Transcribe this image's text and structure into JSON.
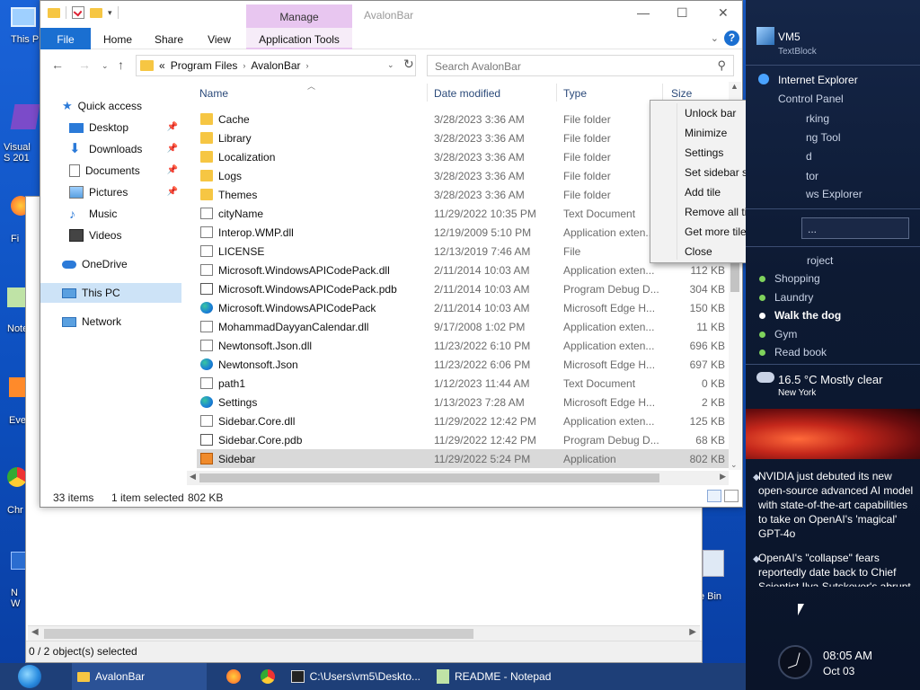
{
  "desktop": {
    "icons": [
      {
        "label": "This P",
        "icon": "pc-icon"
      },
      {
        "label": "Visual S 201",
        "icon": "visual-studio-icon"
      },
      {
        "label": "Fi",
        "icon": "firefox-icon"
      },
      {
        "label": "Note",
        "icon": "notepad-icon"
      },
      {
        "label": "Eve",
        "icon": "app-icon"
      },
      {
        "label": "Chr",
        "icon": "chrome-icon"
      },
      {
        "label": "N W",
        "icon": "app-icon"
      },
      {
        "label": "cle Bin",
        "icon": "recycle-bin-icon"
      }
    ]
  },
  "background_window": {
    "status": "0 / 2 object(s) selected"
  },
  "explorer": {
    "title": "AvalonBar",
    "manage_tab": "Manage",
    "ribbon_tabs": [
      "File",
      "Home",
      "Share",
      "View",
      "Application Tools"
    ],
    "address": {
      "root_glyph": "«",
      "crumbs": [
        "Program Files",
        "AvalonBar"
      ]
    },
    "search_placeholder": "Search AvalonBar",
    "nav": {
      "quick_access": "Quick access",
      "items": [
        {
          "label": "Desktop",
          "pinned": true,
          "icon": "desktop-icon"
        },
        {
          "label": "Downloads",
          "pinned": true,
          "icon": "downloads-icon"
        },
        {
          "label": "Documents",
          "pinned": true,
          "icon": "documents-icon"
        },
        {
          "label": "Pictures",
          "pinned": true,
          "icon": "pictures-icon"
        },
        {
          "label": "Music",
          "pinned": false,
          "icon": "music-icon"
        },
        {
          "label": "Videos",
          "pinned": false,
          "icon": "videos-icon"
        }
      ],
      "onedrive": "OneDrive",
      "thispc": "This PC",
      "network": "Network"
    },
    "columns": {
      "name": "Name",
      "date": "Date modified",
      "type": "Type",
      "size": "Size"
    },
    "files": [
      {
        "name": "Cache",
        "date": "3/28/2023 3:36 AM",
        "type": "File folder",
        "size": "",
        "icon": "folder"
      },
      {
        "name": "Library",
        "date": "3/28/2023 3:36 AM",
        "type": "File folder",
        "size": "",
        "icon": "folder"
      },
      {
        "name": "Localization",
        "date": "3/28/2023 3:36 AM",
        "type": "File folder",
        "size": "",
        "icon": "folder"
      },
      {
        "name": "Logs",
        "date": "3/28/2023 3:36 AM",
        "type": "File folder",
        "size": "",
        "icon": "folder"
      },
      {
        "name": "Themes",
        "date": "3/28/2023 3:36 AM",
        "type": "File folder",
        "size": "",
        "icon": "folder"
      },
      {
        "name": "cityName",
        "date": "11/29/2022 10:35 PM",
        "type": "Text Document",
        "size": "",
        "icon": "doc"
      },
      {
        "name": "Interop.WMP.dll",
        "date": "12/19/2009 5:10 PM",
        "type": "Application exten...",
        "size": "",
        "icon": "dll"
      },
      {
        "name": "LICENSE",
        "date": "12/13/2019 7:46 AM",
        "type": "File",
        "size": "",
        "icon": "doc"
      },
      {
        "name": "Microsoft.WindowsAPICodePack.dll",
        "date": "2/11/2014 10:03 AM",
        "type": "Application exten...",
        "size": "112 KB",
        "icon": "dll"
      },
      {
        "name": "Microsoft.WindowsAPICodePack.pdb",
        "date": "2/11/2014 10:03 AM",
        "type": "Program Debug D...",
        "size": "304 KB",
        "icon": "pdb"
      },
      {
        "name": "Microsoft.WindowsAPICodePack",
        "date": "2/11/2014 10:03 AM",
        "type": "Microsoft Edge H...",
        "size": "150 KB",
        "icon": "edge"
      },
      {
        "name": "MohammadDayyanCalendar.dll",
        "date": "9/17/2008 1:02 PM",
        "type": "Application exten...",
        "size": "11 KB",
        "icon": "dll"
      },
      {
        "name": "Newtonsoft.Json.dll",
        "date": "11/23/2022 6:10 PM",
        "type": "Application exten...",
        "size": "696 KB",
        "icon": "dll"
      },
      {
        "name": "Newtonsoft.Json",
        "date": "11/23/2022 6:06 PM",
        "type": "Microsoft Edge H...",
        "size": "697 KB",
        "icon": "edge"
      },
      {
        "name": "path1",
        "date": "1/12/2023 11:44 AM",
        "type": "Text Document",
        "size": "0 KB",
        "icon": "doc"
      },
      {
        "name": "Settings",
        "date": "1/13/2023 7:28 AM",
        "type": "Microsoft Edge H...",
        "size": "2 KB",
        "icon": "edge"
      },
      {
        "name": "Sidebar.Core.dll",
        "date": "11/29/2022 12:42 PM",
        "type": "Application exten...",
        "size": "125 KB",
        "icon": "dll"
      },
      {
        "name": "Sidebar.Core.pdb",
        "date": "11/29/2022 12:42 PM",
        "type": "Program Debug D...",
        "size": "68 KB",
        "icon": "pdb"
      },
      {
        "name": "Sidebar",
        "date": "11/29/2022 5:24 PM",
        "type": "Application",
        "size": "802 KB",
        "icon": "app",
        "selected": true
      }
    ],
    "status": {
      "count": "33 items",
      "selected": "1 item selected",
      "size": "802 KB"
    }
  },
  "context_menu": {
    "items": [
      {
        "label": "Unlock bar",
        "submenu": false
      },
      {
        "label": "Minimize",
        "submenu": false
      },
      {
        "label": "Settings",
        "submenu": false
      },
      {
        "label": "Set sidebar side",
        "submenu": true
      },
      {
        "label": "Add tile",
        "submenu": true
      },
      {
        "label": "Remove all tiles",
        "submenu": false
      },
      {
        "label": "Get more tiles",
        "submenu": false
      },
      {
        "label": "Close",
        "submenu": false
      }
    ]
  },
  "sidebar": {
    "user": "VM5",
    "user_sub": "TextBlock",
    "links": [
      "Internet Explorer",
      "Control Panel",
      "rking",
      "ng Tool",
      "d",
      "tor",
      "ws Explorer"
    ],
    "search_stub": "...",
    "todo_title": "roject",
    "todos": [
      {
        "label": "Shopping",
        "bold": false,
        "dot": "green"
      },
      {
        "label": "Laundry",
        "bold": false,
        "dot": "green"
      },
      {
        "label": "Walk the dog",
        "bold": true,
        "dot": "white"
      },
      {
        "label": "Gym",
        "bold": false,
        "dot": "green"
      },
      {
        "label": "Read book",
        "bold": false,
        "dot": "green"
      }
    ],
    "weather": {
      "temp": "16.5 °C Mostly clear",
      "city": "New York"
    },
    "news": [
      "NVIDIA just debuted its new open-source advanced AI model with state-of-the-art capabilities to take on OpenAI's 'magical' GPT-4o",
      "OpenAI's \"collapse\" fears reportedly date back to Chief Scientist Ilya Sutskever's abrupt"
    ],
    "time": "08:05 AM",
    "date": "Oct 03"
  },
  "taskbar": {
    "items": [
      {
        "label": "AvalonBar",
        "icon": "folder-icon"
      },
      {
        "label": "",
        "icon": "firefox-icon"
      },
      {
        "label": "",
        "icon": "chrome-icon"
      },
      {
        "label": "C:\\Users\\vm5\\Deskto...",
        "icon": "7zip-icon"
      },
      {
        "label": "README - Notepad",
        "icon": "notepad-icon"
      }
    ]
  }
}
